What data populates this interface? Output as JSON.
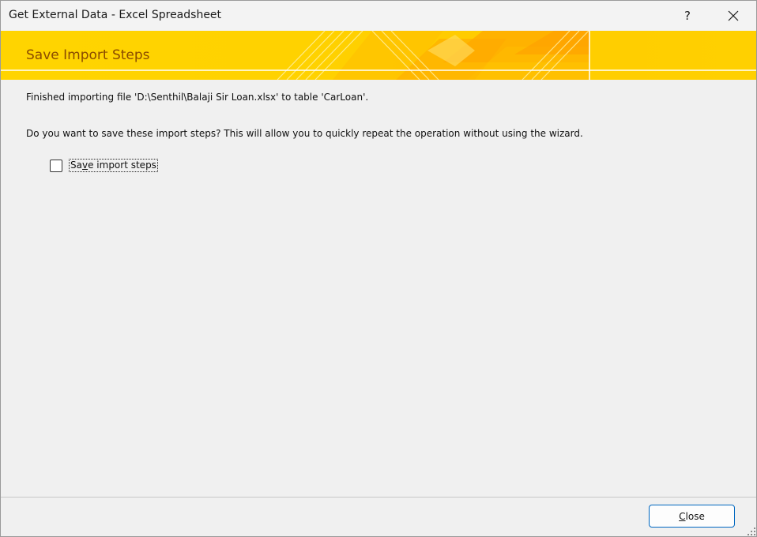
{
  "window": {
    "title": "Get External Data - Excel Spreadsheet",
    "help_glyph": "?",
    "help_icon": "help-icon",
    "close_icon": "close-icon"
  },
  "banner": {
    "title": "Save Import Steps"
  },
  "content": {
    "finished_message": "Finished importing file 'D:\\Senthil\\Balaji Sir Loan.xlsx' to table 'CarLoan'.",
    "save_prompt": "Do you want to save these import steps? This will allow you to quickly repeat the operation without using the wizard.",
    "save_checkbox": {
      "label_before": "Sa",
      "label_mnemonic": "v",
      "label_after": "e import steps",
      "checked": false
    }
  },
  "footer": {
    "close_button": {
      "mnemonic": "C",
      "rest": "lose"
    }
  },
  "colors": {
    "banner_yellow": "#ffd400",
    "banner_title": "#8a4b00",
    "accent_border": "#0067c0",
    "window_bg": "#f0f0f0"
  }
}
